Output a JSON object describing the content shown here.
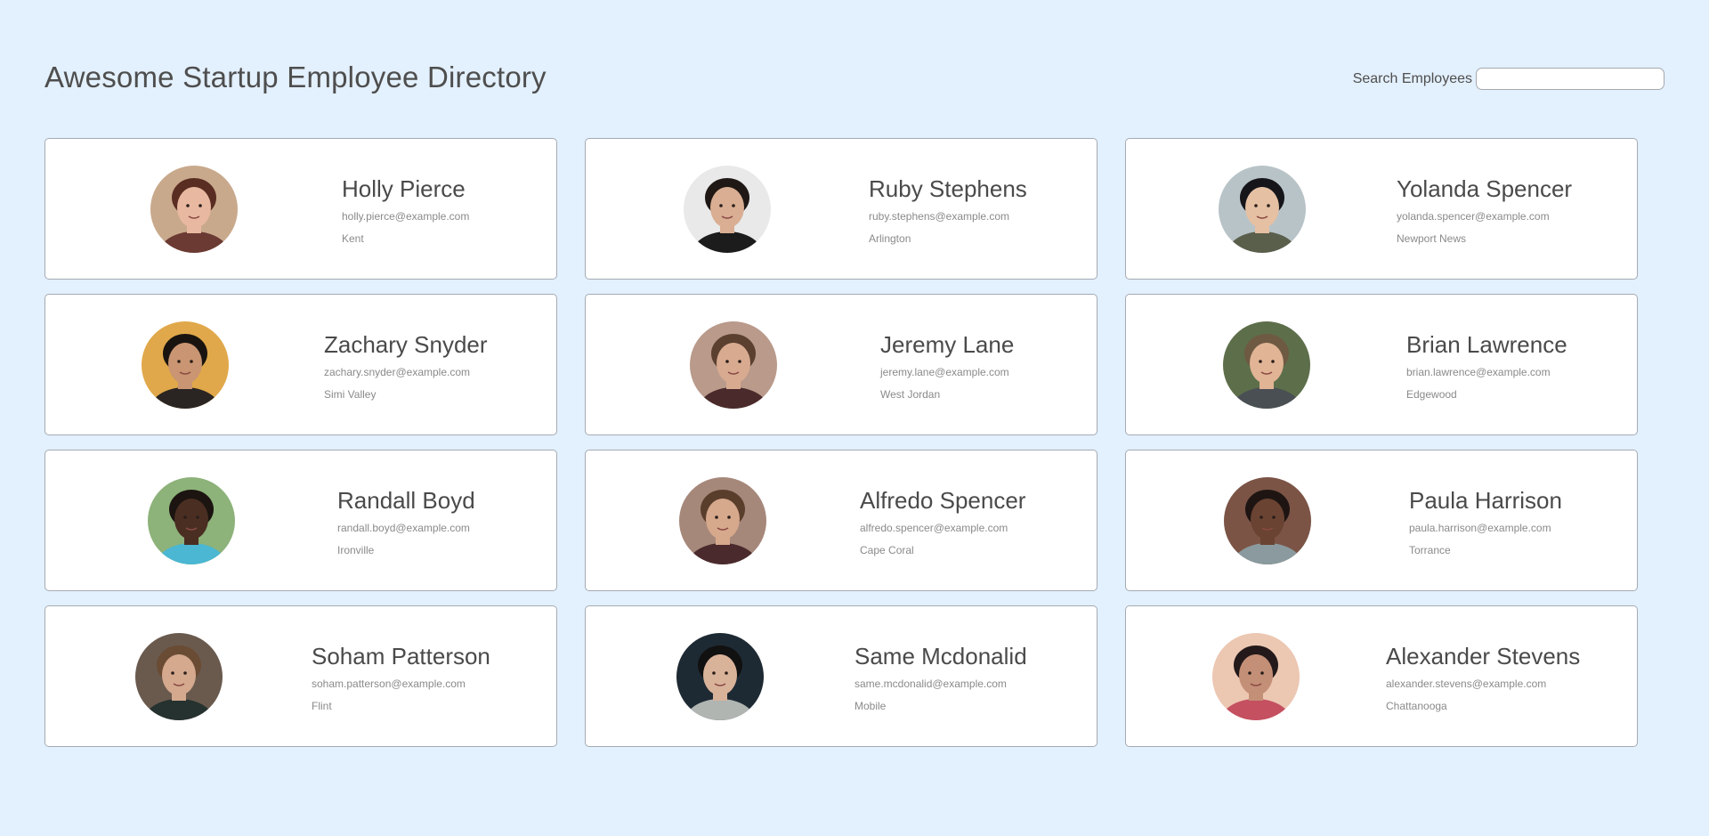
{
  "page": {
    "title": "Awesome Startup Employee Directory",
    "background_color": "#e3f0fd"
  },
  "search": {
    "label": "Search Employees",
    "value": "",
    "placeholder": ""
  },
  "employees": [
    {
      "name": "Holly Pierce",
      "email": "holly.pierce@example.com",
      "city": "Kent",
      "avatar_colors": {
        "bg": "#c9a98c",
        "skin": "#e8b9a0",
        "hair": "#5a2d22",
        "shirt": "#6b3a33"
      }
    },
    {
      "name": "Ruby Stephens",
      "email": "ruby.stephens@example.com",
      "city": "Arlington",
      "avatar_colors": {
        "bg": "#e9e9e9",
        "skin": "#d9ae93",
        "hair": "#1f1814",
        "shirt": "#1c1c1c"
      }
    },
    {
      "name": "Yolanda Spencer",
      "email": "yolanda.spencer@example.com",
      "city": "Newport News",
      "avatar_colors": {
        "bg": "#b8c3c8",
        "skin": "#e5c0a3",
        "hair": "#15151a",
        "shirt": "#5a5f4c"
      }
    },
    {
      "name": "Zachary Snyder",
      "email": "zachary.snyder@example.com",
      "city": "Simi Valley",
      "avatar_colors": {
        "bg": "#e0a84a",
        "skin": "#c99572",
        "hair": "#1a1410",
        "shirt": "#2a2522"
      }
    },
    {
      "name": "Jeremy Lane",
      "email": "jeremy.lane@example.com",
      "city": "West Jordan",
      "avatar_colors": {
        "bg": "#b99a8b",
        "skin": "#d8ab90",
        "hair": "#5b4030",
        "shirt": "#4a2a2a"
      }
    },
    {
      "name": "Brian Lawrence",
      "email": "brian.lawrence@example.com",
      "city": "Edgewood",
      "avatar_colors": {
        "bg": "#5d6e4a",
        "skin": "#e0b495",
        "hair": "#6e5a43",
        "shirt": "#4a4f54"
      }
    },
    {
      "name": "Randall Boyd",
      "email": "randall.boyd@example.com",
      "city": "Ironville",
      "avatar_colors": {
        "bg": "#8db27a",
        "skin": "#4a2e22",
        "hair": "#1b1410",
        "shirt": "#4bb7d2"
      }
    },
    {
      "name": "Alfredo Spencer",
      "email": "alfredo.spencer@example.com",
      "city": "Cape Coral",
      "avatar_colors": {
        "bg": "#a6887a",
        "skin": "#d6a88c",
        "hair": "#5a3e2c",
        "shirt": "#4a2a2c"
      }
    },
    {
      "name": "Paula Harrison",
      "email": "paula.harrison@example.com",
      "city": "Torrance",
      "avatar_colors": {
        "bg": "#7b5446",
        "skin": "#6a4332",
        "hair": "#1e1512",
        "shirt": "#8a9a9e"
      }
    },
    {
      "name": "Soham Patterson",
      "email": "soham.patterson@example.com",
      "city": "Flint",
      "avatar_colors": {
        "bg": "#6a5a4e",
        "skin": "#d4a98e",
        "hair": "#6a4b34",
        "shirt": "#263230"
      }
    },
    {
      "name": "Same Mcdonalid",
      "email": "same.mcdonalid@example.com",
      "city": "Mobile",
      "avatar_colors": {
        "bg": "#1e2a33",
        "skin": "#d9b29a",
        "hair": "#111111",
        "shirt": "#b0b5b2"
      }
    },
    {
      "name": "Alexander Stevens",
      "email": "alexander.stevens@example.com",
      "city": "Chattanooga",
      "avatar_colors": {
        "bg": "#ecc7b2",
        "skin": "#c48f77",
        "hair": "#23191a",
        "shirt": "#c45060"
      }
    }
  ]
}
